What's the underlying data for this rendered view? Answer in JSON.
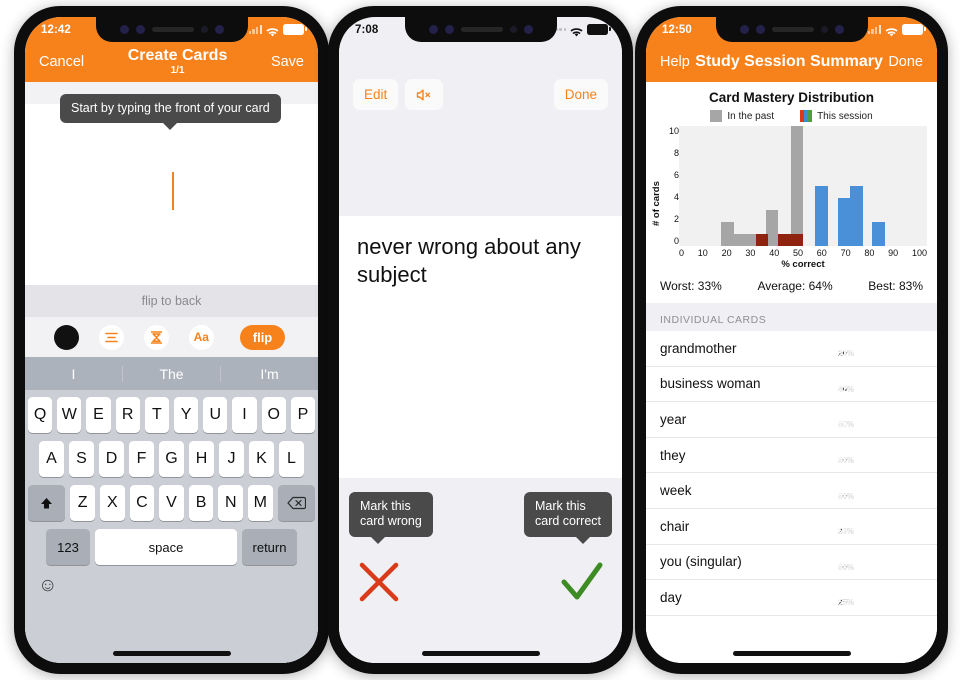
{
  "phone1": {
    "status": {
      "time": "12:42",
      "signal_icon": "cellular-bars-icon",
      "wifi_icon": "wifi-icon",
      "battery_icon": "battery-icon"
    },
    "nav": {
      "left": "Cancel",
      "title": "Create Cards",
      "subtitle": "1/1",
      "right": "Save"
    },
    "tooltip": "Start by typing the front of your card",
    "flip_label": "flip to back",
    "toolbar": {
      "color_icon": "color-dot-icon",
      "align_icon": "text-align-icon",
      "vertical_align_icon": "vertical-align-icon",
      "font_size_icon": "font-size-icon",
      "font_size_label": "Aa",
      "flip_button": "flip"
    },
    "suggestions": [
      "I",
      "The",
      "I'm"
    ],
    "keyboard": {
      "row1": [
        "Q",
        "W",
        "E",
        "R",
        "T",
        "Y",
        "U",
        "I",
        "O",
        "P"
      ],
      "row2": [
        "A",
        "S",
        "D",
        "F",
        "G",
        "H",
        "J",
        "K",
        "L"
      ],
      "row3": [
        "Z",
        "X",
        "C",
        "V",
        "B",
        "N",
        "M"
      ],
      "shift_icon": "shift-icon",
      "backspace_icon": "backspace-icon",
      "numbers": "123",
      "space": "space",
      "return": "return",
      "emoji_icon": "emoji-icon"
    }
  },
  "phone2": {
    "status": {
      "time": "7:08",
      "signal_icon": "cellular-dots-icon",
      "wifi_icon": "wifi-icon",
      "battery_icon": "battery-icon"
    },
    "buttons": {
      "edit": "Edit",
      "mute_icon": "speaker-mute-icon",
      "done": "Done"
    },
    "question": "never wrong about any subject",
    "tooltip_wrong": "Mark this\ncard wrong",
    "tooltip_correct": "Mark this\ncard correct",
    "wrong_icon": "x-mark-icon",
    "correct_icon": "check-mark-icon"
  },
  "phone3": {
    "status": {
      "time": "12:50",
      "signal_icon": "cellular-bars-icon",
      "wifi_icon": "wifi-icon",
      "battery_icon": "battery-icon"
    },
    "nav": {
      "left": "Help",
      "title": "Study Session Summary",
      "right": "Done"
    },
    "stats": {
      "worst": "Worst: 33%",
      "average": "Average: 64%",
      "best": "Best: 83%"
    },
    "section_header": "INDIVIDUAL CARDS",
    "cards": [
      {
        "name": "grandmother",
        "past": "20%",
        "past_val": 20,
        "now": "33%",
        "now_val": 33
      },
      {
        "name": "business woman",
        "past": "40%",
        "past_val": 40,
        "now": "42%",
        "now_val": 42
      },
      {
        "name": "year",
        "past": "50%",
        "past_val": 50,
        "now": "50%",
        "now_val": 50
      },
      {
        "name": "they",
        "past": "50%",
        "past_val": 50,
        "now": "58%",
        "now_val": 58
      },
      {
        "name": "week",
        "past": "50%",
        "past_val": 50,
        "now": "58%",
        "now_val": 58
      },
      {
        "name": "chair",
        "past": "33%",
        "past_val": 33,
        "now": "58%",
        "now_val": 58
      },
      {
        "name": "you (singular)",
        "past": "50%",
        "past_val": 50,
        "now": "58%",
        "now_val": 58
      },
      {
        "name": "day",
        "past": "25%",
        "past_val": 25,
        "now": "58%",
        "now_val": 58
      }
    ]
  },
  "chart_data": {
    "type": "bar",
    "title": "Card Mastery Distribution",
    "xlabel": "% correct",
    "ylabel": "# of cards",
    "xlim": [
      0,
      100
    ],
    "ylim": [
      0,
      10
    ],
    "xticks": [
      0,
      10,
      20,
      30,
      40,
      50,
      60,
      70,
      80,
      90,
      100
    ],
    "yticks": [
      0,
      2,
      4,
      6,
      8,
      10
    ],
    "grid": false,
    "legend": [
      {
        "label": "In the past",
        "color": "#A6A6A6"
      },
      {
        "label": "This session",
        "color": "#D93B1A"
      }
    ],
    "legend_position": "top-center",
    "bins": [
      0,
      5,
      10,
      15,
      20,
      25,
      30,
      35,
      40,
      45,
      50,
      55,
      60,
      65,
      70,
      75,
      80,
      85,
      90,
      95,
      100
    ],
    "series": [
      {
        "name": "In the past",
        "color": "#A6A6A6",
        "bars": [
          {
            "x0": 17,
            "x1": 22,
            "value": 2
          },
          {
            "x0": 22,
            "x1": 27,
            "value": 1
          },
          {
            "x0": 27,
            "x1": 31,
            "value": 1
          },
          {
            "x0": 35,
            "x1": 40,
            "value": 3
          },
          {
            "x0": 45,
            "x1": 50,
            "value": 10
          }
        ]
      },
      {
        "name": "This session",
        "color": "#8E2310",
        "bars": [
          {
            "x0": 31,
            "x1": 36,
            "value": 1
          },
          {
            "x0": 40,
            "x1": 45,
            "value": 1
          },
          {
            "x0": 45,
            "x1": 50,
            "value": 1
          }
        ]
      },
      {
        "name": "This session (blue)",
        "color": "#4A90D9",
        "bars": [
          {
            "x0": 55,
            "x1": 60,
            "value": 5
          },
          {
            "x0": 64,
            "x1": 69,
            "value": 4
          },
          {
            "x0": 69,
            "x1": 74,
            "value": 5
          },
          {
            "x0": 78,
            "x1": 83,
            "value": 2
          }
        ]
      }
    ]
  }
}
